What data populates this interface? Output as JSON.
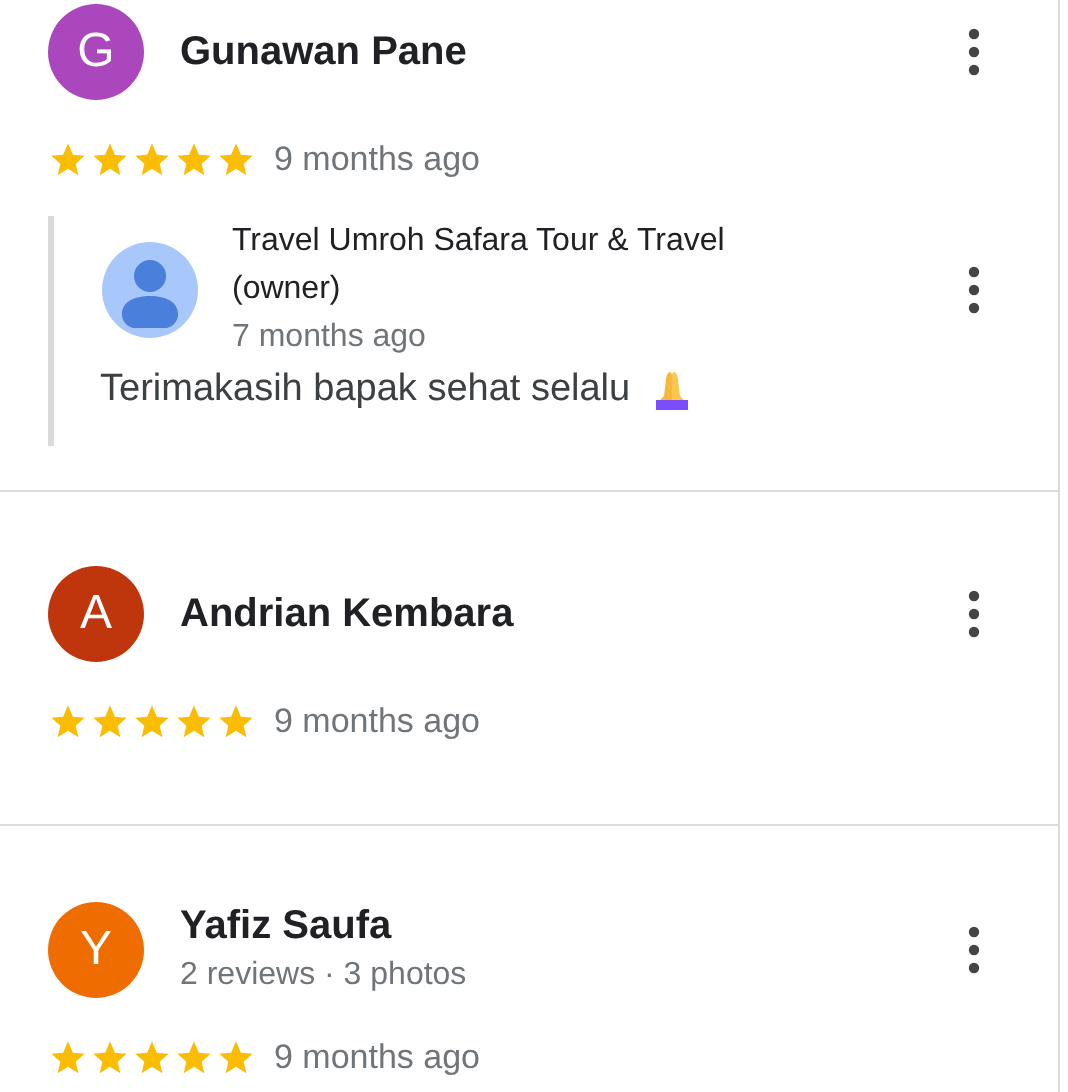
{
  "reviews": [
    {
      "avatar_letter": "G",
      "color": "#ab47bc",
      "name": "Gunawan Pane",
      "stars": 5,
      "time": "9 months ago",
      "reply": {
        "owner": "Travel Umroh Safara Tour & Travel (owner)",
        "time": "7 months ago",
        "text": "Terimakasih bapak sehat selalu"
      }
    },
    {
      "avatar_letter": "A",
      "color": "#bf360c",
      "name": "Andrian Kembara",
      "stars": 5,
      "time": "9 months ago"
    },
    {
      "avatar_letter": "Y",
      "color": "#ef6c00",
      "name": "Yafiz Saufa",
      "subtitle": "2 reviews · 3 photos",
      "stars": 5,
      "time": "9 months ago"
    }
  ]
}
